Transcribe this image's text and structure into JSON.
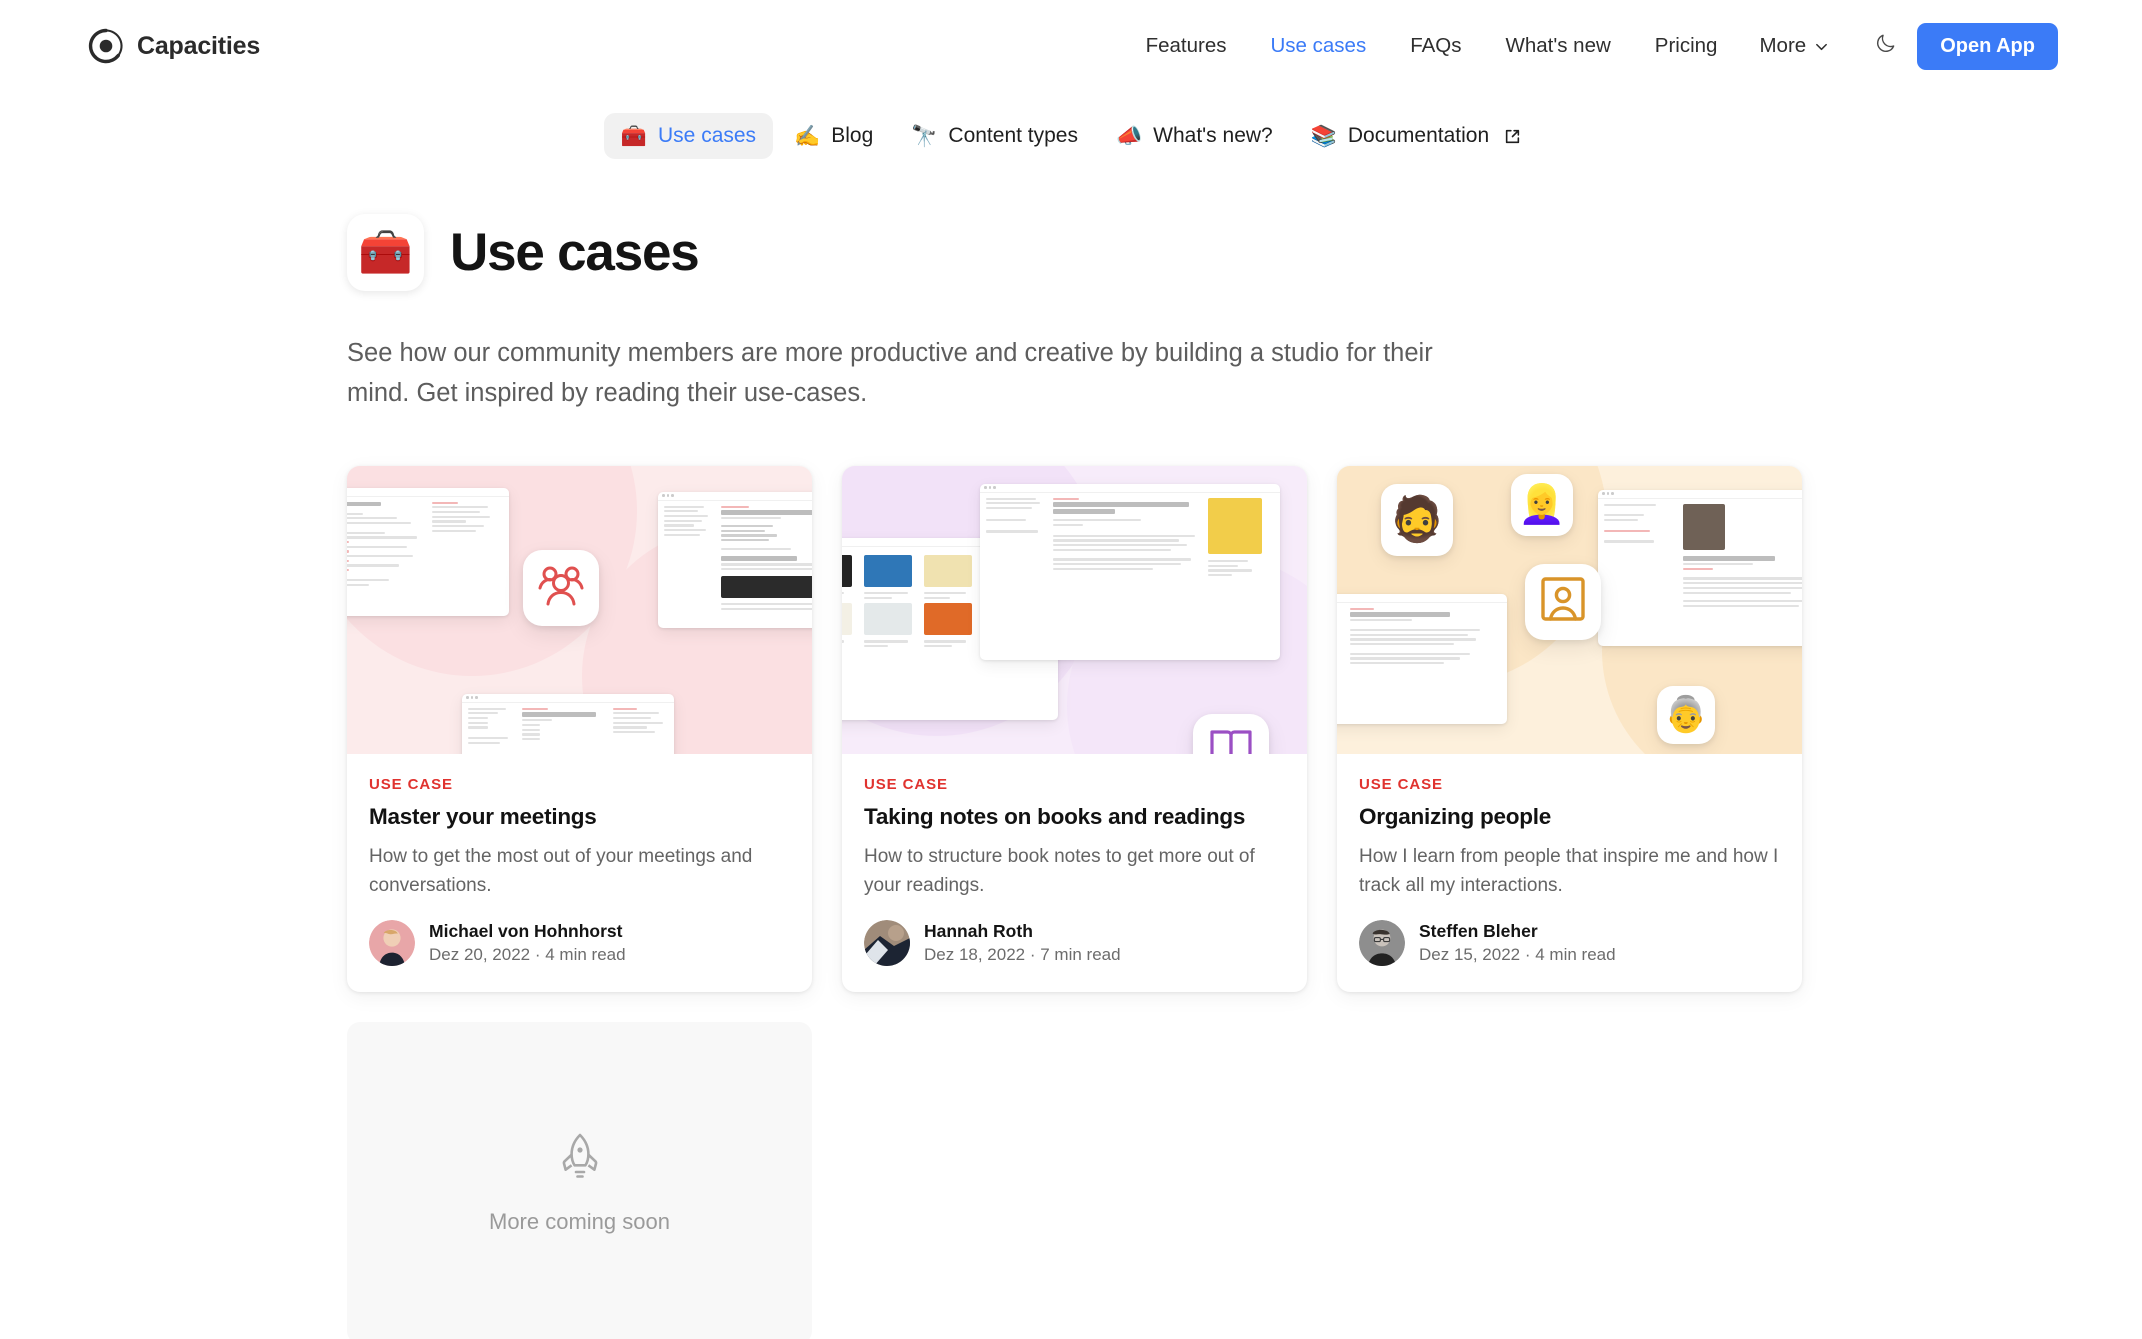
{
  "brand": {
    "name": "Capacities",
    "logo_icon": "capacities-logo-icon"
  },
  "header": {
    "nav": [
      {
        "label": "Features",
        "active": false
      },
      {
        "label": "Use cases",
        "active": true
      },
      {
        "label": "FAQs",
        "active": false
      },
      {
        "label": "What's new",
        "active": false
      },
      {
        "label": "Pricing",
        "active": false
      }
    ],
    "more_label": "More",
    "more_icon": "chevron-down-icon",
    "theme_toggle_icon": "moon-icon",
    "open_app_label": "Open App",
    "accent_blue": "#3b7bf7"
  },
  "subnav": [
    {
      "label": "Use cases",
      "emoji": "🧰",
      "icon": "toolbox-icon",
      "active": true,
      "external": false
    },
    {
      "label": "Blog",
      "emoji": "✍️",
      "icon": "writing-hand-icon",
      "active": false,
      "external": false
    },
    {
      "label": "Content types",
      "emoji": "🔭",
      "icon": "telescope-icon",
      "active": false,
      "external": false
    },
    {
      "label": "What's new?",
      "emoji": "📣",
      "icon": "megaphone-icon",
      "active": false,
      "external": false
    },
    {
      "label": "Documentation",
      "emoji": "📚",
      "icon": "books-icon",
      "active": false,
      "external": true
    }
  ],
  "page": {
    "badge_emoji": "🧰",
    "badge_icon": "toolbox-icon",
    "title": "Use cases",
    "description": "See how our community members are more productive and creative by building a studio for their mind. Get inspired by reading their use-cases."
  },
  "cards": [
    {
      "kicker": "USE CASE",
      "title": "Master your meetings",
      "description": "How to get the most out of your meetings and conversations.",
      "author": "Michael von Hohnhorst",
      "meta": "Dez 20, 2022 · 4 min read",
      "theme": "pink",
      "glyph_icon": "people-group-icon",
      "glyph_color": "#e0504f"
    },
    {
      "kicker": "USE CASE",
      "title": "Taking notes on books and readings",
      "description": "How to structure book notes to get more out of your readings.",
      "author": "Hannah Roth",
      "meta": "Dez 18, 2022 · 7 min read",
      "theme": "purple",
      "glyph_icon": "open-book-icon",
      "glyph_color": "#9b4fc4"
    },
    {
      "kicker": "USE CASE",
      "title": "Organizing people",
      "description": "How I learn from people that inspire me and how I track all my interactions.",
      "author": "Steffen Bleher",
      "meta": "Dez 15, 2022 · 4 min read",
      "theme": "amber",
      "glyph_icon": "person-portrait-icon",
      "glyph_color": "#d99429",
      "emoji_tiles": [
        "🧔",
        "👱‍♀️",
        "👵"
      ]
    }
  ],
  "coming_soon": {
    "label": "More coming soon",
    "icon": "rocket-icon"
  },
  "colors": {
    "accent": "#3b7bf7",
    "kicker_red": "#e0332f",
    "pink_bg": "#fcebeb",
    "purple_bg": "#f7ecfa",
    "amber_bg": "#fdf0dc",
    "coming_bg": "#f8f8f8"
  }
}
